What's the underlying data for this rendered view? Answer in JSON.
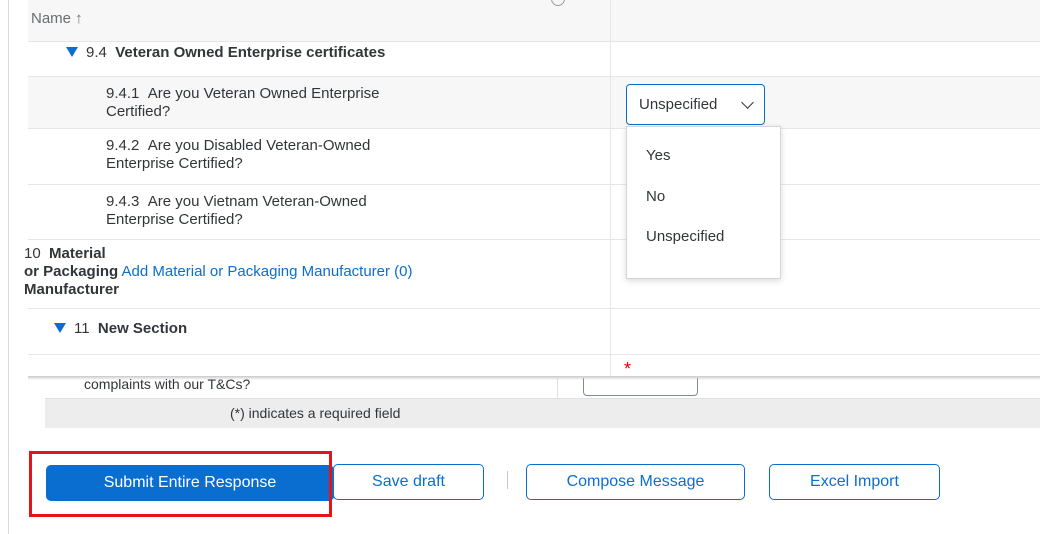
{
  "table": {
    "header": {
      "name_label": "Name ↑"
    },
    "section_9_4": {
      "number": "9.4",
      "title": "Veteran Owned Enterprise certificates"
    },
    "questions": [
      {
        "number": "9.4.1",
        "text": "Are you Veteran Owned Enterprise Certified?"
      },
      {
        "number": "9.4.2",
        "text": "Are you Disabled Veteran-Owned Enterprise Certified?"
      },
      {
        "number": "9.4.3",
        "text": "Are you Vietnam Veteran-Owned Enterprise Certified?"
      }
    ],
    "section_10": {
      "number": "10",
      "title_line1": "Material",
      "title_line2": "or Packaging",
      "title_line3": "Manufacturer",
      "link": "Add Material or Packaging Manufacturer (0)"
    },
    "section_11": {
      "number": "11",
      "title": "New Section"
    },
    "required_marker": "*"
  },
  "dropdown": {
    "value": "Unspecified",
    "options": [
      "Yes",
      "No",
      "Unspecified"
    ]
  },
  "background": {
    "question_fragment": "complaints with our T&Cs?",
    "required_note": "(*) indicates a required field"
  },
  "buttons": {
    "submit": "Submit Entire Response",
    "save_draft": "Save draft",
    "compose": "Compose Message",
    "excel": "Excel Import"
  },
  "colors": {
    "accent": "#0a6ed1",
    "highlight": "#e3141c",
    "required": "#e00000"
  }
}
